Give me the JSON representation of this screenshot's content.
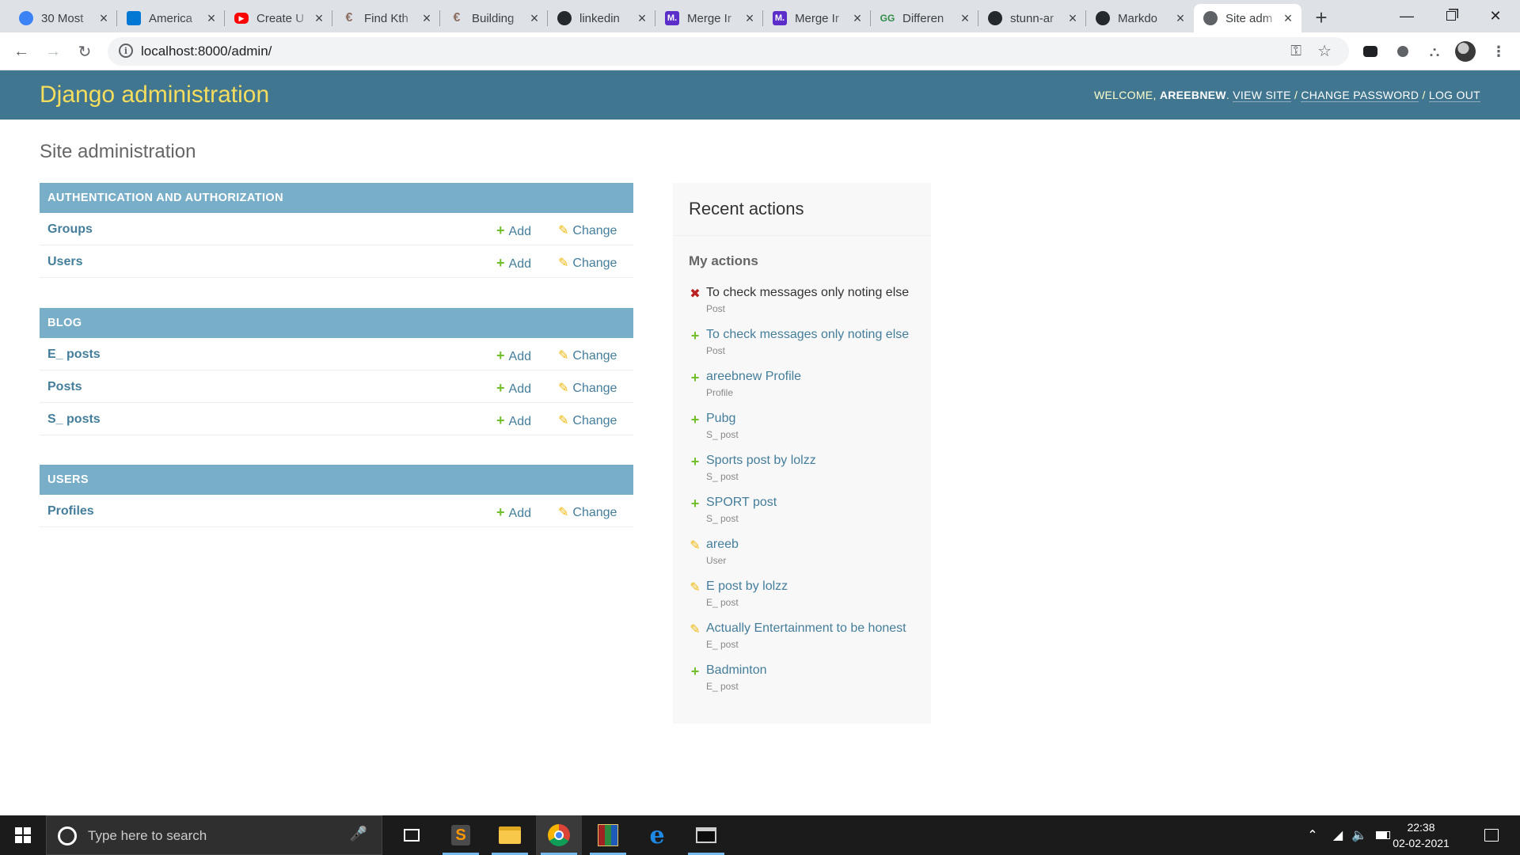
{
  "browser": {
    "tabs": [
      {
        "title": "30 Most",
        "icon": "spiral-icon",
        "color": "#3b82f6"
      },
      {
        "title": "America",
        "icon": "azure-icon",
        "color": "#0078d4"
      },
      {
        "title": "Create U",
        "icon": "youtube-icon",
        "color": "#ff0000"
      },
      {
        "title": "Find Kth",
        "icon": "geeks-icon",
        "color": "#8d6e63"
      },
      {
        "title": "Building",
        "icon": "geeks-icon",
        "color": "#8d6e63"
      },
      {
        "title": "linkedin",
        "icon": "github-icon",
        "color": "#24292e"
      },
      {
        "title": "Merge Ir",
        "icon": "medium-icon",
        "color": "#5b2ec9"
      },
      {
        "title": "Merge Ir",
        "icon": "medium-icon",
        "color": "#5b2ec9"
      },
      {
        "title": "Differen",
        "icon": "gfg-icon",
        "color": "#2f8d46"
      },
      {
        "title": "stunn-ar",
        "icon": "github-icon",
        "color": "#24292e"
      },
      {
        "title": "Markdo",
        "icon": "github-icon",
        "color": "#24292e"
      },
      {
        "title": "Site adm",
        "icon": "globe-icon",
        "color": "#5f6368"
      }
    ],
    "url": "localhost:8000/admin/"
  },
  "header": {
    "brand": "Django administration",
    "welcome": "WELCOME, ",
    "username": "AREEBNEW",
    "view_site": "VIEW SITE",
    "change_password": "CHANGE PASSWORD",
    "log_out": "LOG OUT"
  },
  "content": {
    "title": "Site administration",
    "add_label": "Add",
    "change_label": "Change",
    "modules": [
      {
        "caption": "Authentication and Authorization",
        "models": [
          "Groups",
          "Users"
        ]
      },
      {
        "caption": "Blog",
        "models": [
          "E_ posts",
          "Posts",
          "S_ posts"
        ]
      },
      {
        "caption": "Users",
        "models": [
          "Profiles"
        ]
      }
    ]
  },
  "recent": {
    "title": "Recent actions",
    "subtitle": "My actions",
    "actions": [
      {
        "text": "To check messages only noting else",
        "type": "Post",
        "kind": "delete"
      },
      {
        "text": "To check messages only noting else",
        "type": "Post",
        "kind": "add"
      },
      {
        "text": "areebnew Profile",
        "type": "Profile",
        "kind": "add"
      },
      {
        "text": "Pubg",
        "type": "S_ post",
        "kind": "add"
      },
      {
        "text": "Sports post by lolzz",
        "type": "S_ post",
        "kind": "add"
      },
      {
        "text": "SPORT post",
        "type": "S_ post",
        "kind": "add"
      },
      {
        "text": "areeb",
        "type": "User",
        "kind": "change"
      },
      {
        "text": "E post by lolzz",
        "type": "E_ post",
        "kind": "change"
      },
      {
        "text": "Actually Entertainment to be honest",
        "type": "E_ post",
        "kind": "change"
      },
      {
        "text": "Badminton",
        "type": "E_ post",
        "kind": "add"
      }
    ]
  },
  "taskbar": {
    "search_placeholder": "Type here to search",
    "time": "22:38",
    "date": "02-02-2021",
    "apps": [
      "task-view-icon",
      "sublime-text-icon",
      "file-explorer-icon",
      "chrome-icon",
      "winrar-icon",
      "edge-icon",
      "terminal-icon"
    ]
  },
  "colors": {
    "header_bg": "#417690",
    "brand_yellow": "#f5dd5d",
    "caption_bg": "#79aec8",
    "link": "#447e9b",
    "add_green": "#70bf2b",
    "change_yellow": "#efb80b",
    "delete_red": "#ba2121"
  }
}
